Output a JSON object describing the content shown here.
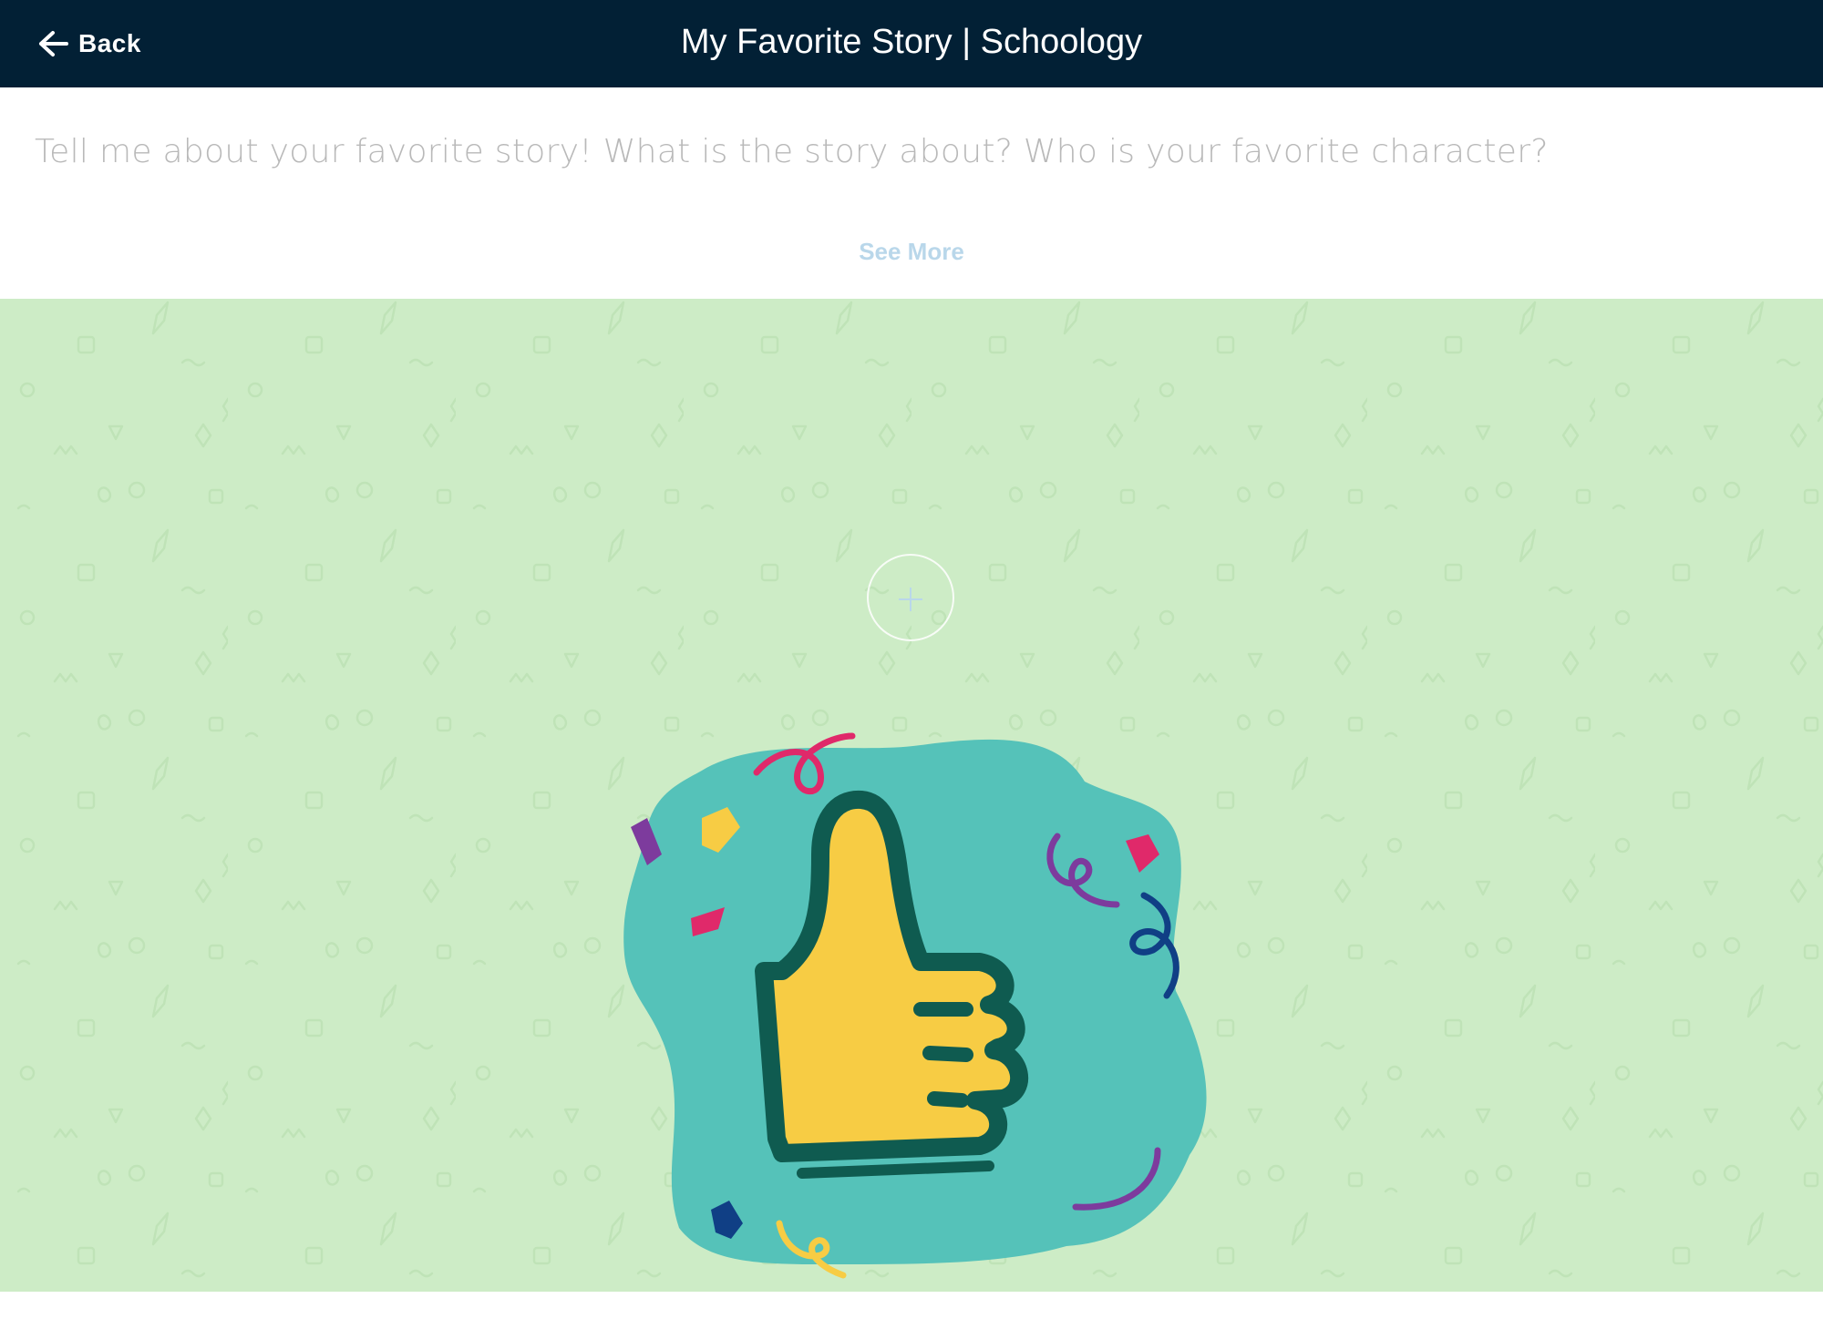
{
  "header": {
    "back_label": "Back",
    "title": "My Favorite Story | Schoology",
    "back_icon": "arrow-left-icon"
  },
  "prompt": {
    "text": "Tell me about your favorite story! What is the story about? Who is your favorite character?",
    "see_more_label": "See More"
  },
  "canvas": {
    "expand_icon": "plus-icon",
    "illustration": "thumbs-up-icon"
  },
  "colors": {
    "header_bg": "#022035",
    "canvas_bg": "#cdecc6",
    "prompt_text": "#b9b9b9",
    "see_more": "#b9d7ea",
    "teal_blob": "#55c2b9",
    "thumb_fill": "#f7cc44",
    "thumb_outline": "#0f5b50"
  }
}
